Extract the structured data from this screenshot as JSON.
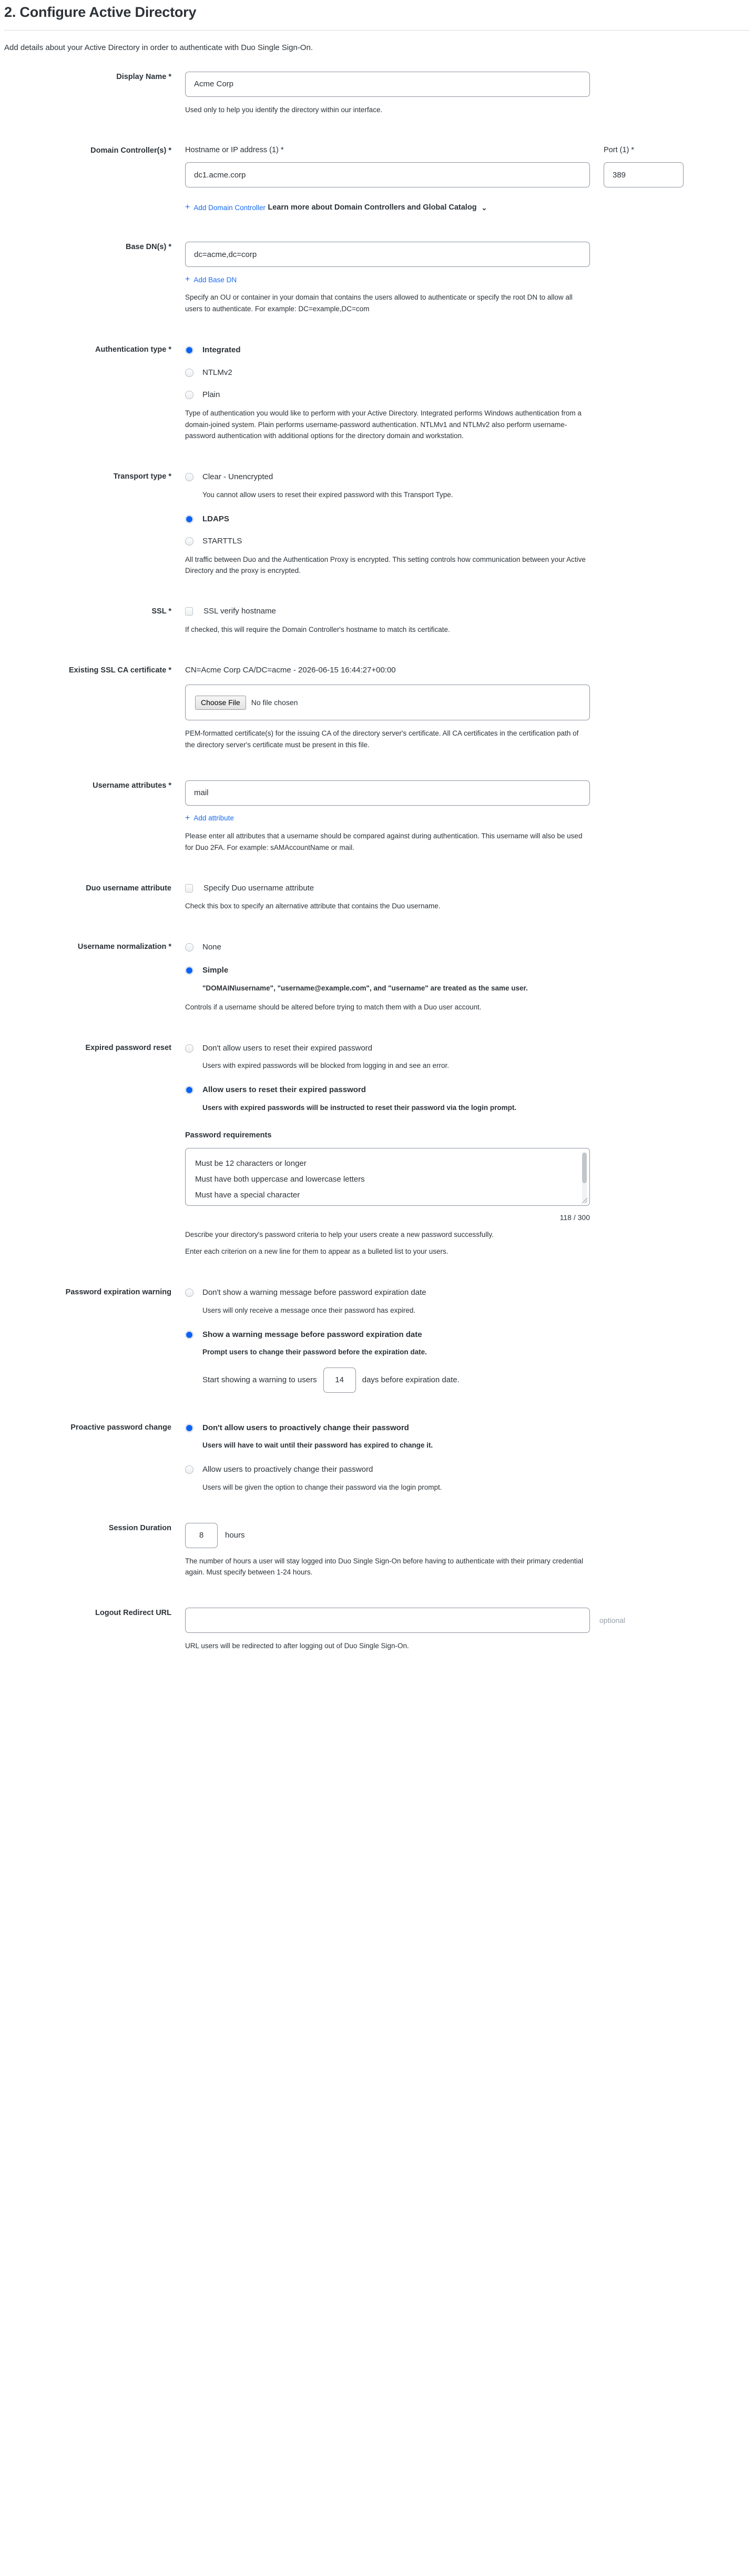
{
  "header": {
    "title": "2. Configure Active Directory",
    "intro": "Add details about your Active Directory in order to authenticate with Duo Single Sign-On."
  },
  "display_name": {
    "label": "Display Name *",
    "value": "Acme Corp",
    "placeholder": "",
    "help": "Used only to help you identify the directory within our interface."
  },
  "domain_controllers": {
    "label": "Domain Controller(s) *",
    "host_sublabel": "Hostname or IP address (1) *",
    "port_sublabel": "Port (1) *",
    "host_value": "dc1.acme.corp",
    "port_value": "389",
    "add_link": "Add Domain Controller",
    "plus_glyph": "+",
    "disclosure": "Learn more about Domain Controllers and Global Catalog",
    "chevron_glyph": "⌄"
  },
  "base_dn": {
    "label": "Base DN(s) *",
    "value": "dc=acme,dc=corp",
    "add_link": "Add Base DN",
    "help": "Specify an OU or container in your domain that contains the users allowed to authenticate or specify the root DN to allow all users to authenticate. For example: DC=example,DC=com"
  },
  "auth_type": {
    "label": "Authentication type *",
    "options": [
      {
        "label": "Integrated",
        "selected": true
      },
      {
        "label": "NTLMv2",
        "selected": false
      },
      {
        "label": "Plain",
        "selected": false
      }
    ],
    "help": "Type of authentication you would like to perform with your Active Directory. Integrated performs Windows authentication from a domain-joined system. Plain performs username-password authentication. NTLMv1 and NTLMv2 also perform username-password authentication with additional options for the directory domain and workstation."
  },
  "transport_type": {
    "label": "Transport type *",
    "options": [
      {
        "label": "Clear - Unencrypted",
        "selected": false,
        "note": "You cannot allow users to reset their expired password with this Transport Type."
      },
      {
        "label": "LDAPS",
        "selected": true,
        "note": ""
      },
      {
        "label": "STARTTLS",
        "selected": false,
        "note": ""
      }
    ],
    "help": "All traffic between Duo and the Authentication Proxy is encrypted. This setting controls how communication between your Active Directory and the proxy is encrypted."
  },
  "ssl": {
    "label": "SSL *",
    "checkbox_label": "SSL verify hostname",
    "checked": false,
    "help": "If checked, this will require the Domain Controller's hostname to match its certificate."
  },
  "ssl_ca_cert": {
    "label": "Existing SSL CA certificate *",
    "current_value": "CN=Acme Corp CA/DC=acme - 2026-06-15 16:44:27+00:00",
    "choose_file_label": "Choose File",
    "no_file_label": "No file chosen",
    "help": "PEM-formatted certificate(s) for the issuing CA of the directory server's certificate. All CA certificates in the certification path of the directory server's certificate must be present in this file."
  },
  "username_attributes": {
    "label": "Username attributes *",
    "value": "mail",
    "add_link": "Add attribute",
    "help": "Please enter all attributes that a username should be compared against during authentication. This username will also be used for Duo 2FA. For example: sAMAccountName or mail."
  },
  "duo_username_attribute": {
    "label": "Duo username attribute",
    "checkbox_label": "Specify Duo username attribute",
    "checked": false,
    "help": "Check this box to specify an alternative attribute that contains the Duo username."
  },
  "username_normalization": {
    "label": "Username normalization *",
    "options": [
      {
        "label": "None",
        "selected": false,
        "note": ""
      },
      {
        "label": "Simple",
        "selected": true,
        "note": "\"DOMAIN\\username\", \"username@example.com\", and \"username\" are treated as the same user."
      }
    ],
    "help": "Controls if a username should be altered before trying to match them with a Duo user account."
  },
  "expired_password_reset": {
    "label": "Expired password reset",
    "options": [
      {
        "label": "Don't allow users to reset their expired password",
        "selected": false,
        "note": "Users with expired passwords will be blocked from logging in and see an error."
      },
      {
        "label": "Allow users to reset their expired password",
        "selected": true,
        "note": "Users with expired passwords will be instructed to reset their password via the login prompt."
      }
    ],
    "requirements_title": "Password requirements",
    "requirements_value": "Must be 12 characters or longer\nMust have both uppercase and lowercase letters\nMust have a special character",
    "counter": "118 / 300",
    "help_line_1": "Describe your directory's password criteria to help your users create a new password successfully.",
    "help_line_2": "Enter each criterion on a new line for them to appear as a bulleted list to your users."
  },
  "password_expiration_warning": {
    "label": "Password expiration warning",
    "options": [
      {
        "label": "Don't show a warning message before password expiration date",
        "selected": false,
        "note": "Users will only receive a message once their password has expired."
      },
      {
        "label": "Show a warning message before password expiration date",
        "selected": true,
        "note": "Prompt users to change their password before the expiration date."
      }
    ],
    "days_prefix": "Start showing a warning to users",
    "days_value": "14",
    "days_suffix": "days before expiration date."
  },
  "proactive_password_change": {
    "label": "Proactive password change",
    "options": [
      {
        "label": "Don't allow users to proactively change their password",
        "selected": true,
        "note": "Users will have to wait until their password has expired to change it."
      },
      {
        "label": "Allow users to proactively change their password",
        "selected": false,
        "note": "Users will be given the option to change their password via the login prompt."
      }
    ]
  },
  "session_duration": {
    "label": "Session Duration",
    "value": "8",
    "unit": "hours",
    "help": "The number of hours a user will stay logged into Duo Single Sign-On before having to authenticate with their primary credential again. Must specify between 1-24 hours."
  },
  "logout_redirect_url": {
    "label": "Logout Redirect URL",
    "value": "",
    "placeholder": "",
    "optional_tag": "optional",
    "help": "URL users will be redirected to after logging out of Duo Single Sign-On."
  },
  "colors": {
    "link": "#1a6cf0",
    "radio_selected": "#0b63f6",
    "text": "#2c3238",
    "border": "#8e96a0"
  }
}
